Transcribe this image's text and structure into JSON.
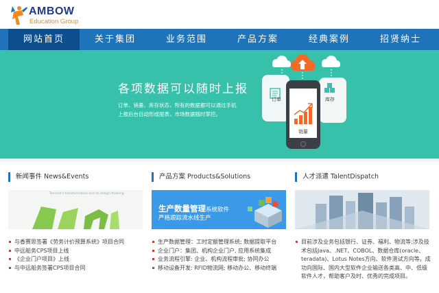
{
  "brand": {
    "title": "AMBOW",
    "subtitle": "Education Group"
  },
  "nav": {
    "items": [
      {
        "label": "网站首页",
        "active": true
      },
      {
        "label": "关于集团",
        "active": false
      },
      {
        "label": "业务范围",
        "active": false
      },
      {
        "label": "产品方案",
        "active": false
      },
      {
        "label": "经典案例",
        "active": false
      },
      {
        "label": "招贤纳士",
        "active": false
      }
    ]
  },
  "banner": {
    "title": "各项数据可以随时上报",
    "description": "订单、销量、库存状态，所有的数据都可以通过手机上报后台自动形成报表，市场数据随时掌控。",
    "card_order": "订单",
    "card_inventory": "库存",
    "phone_label": "销量"
  },
  "news": {
    "heading": "新闻事件 News&Events",
    "image_caption": "Tencent's transformation and its design thinking",
    "items": [
      "与香赛思签署《劳务计价预算系统》项目合同",
      "中远船务CPS项目上线",
      "《企业门户项目》上线",
      "与中远船务签署CPS项目合同"
    ]
  },
  "products": {
    "heading": "产品方案 Products&Solutions",
    "image_title": "生产数量管理",
    "image_title_suffix": "系统软件",
    "image_subtitle": "严格跟踪流水线生产",
    "items": [
      "生产数据管理：工时定额管理系统; 数据提取平台",
      "企业门户：集团、机构企业门户, 应用系统集成",
      "业务流程引擎: 企业、机构流程审批; 协同办公",
      "移动设备开发: RFID物流网; 移动办公、移动终端"
    ]
  },
  "talent": {
    "heading": "人才派遣 TalentDispatch",
    "paragraph": "目前涉及业务包括银行、证券、福利、物流等;涉及技术包括Java、.NET、COBOL、数据仓库(oracle、teradata)、Lotus Notes方向、软件测试方向等。成功向国际、国内大型软件企业输送各类高、中、低级软件人才，帮助客户及时、优秀的完成项目。"
  },
  "colors": {
    "nav": "#1e73b9",
    "nav_active": "#0c4f8c",
    "banner": "#37c0aa",
    "accent_orange": "#f46a25",
    "bullet": "#e2322b"
  }
}
